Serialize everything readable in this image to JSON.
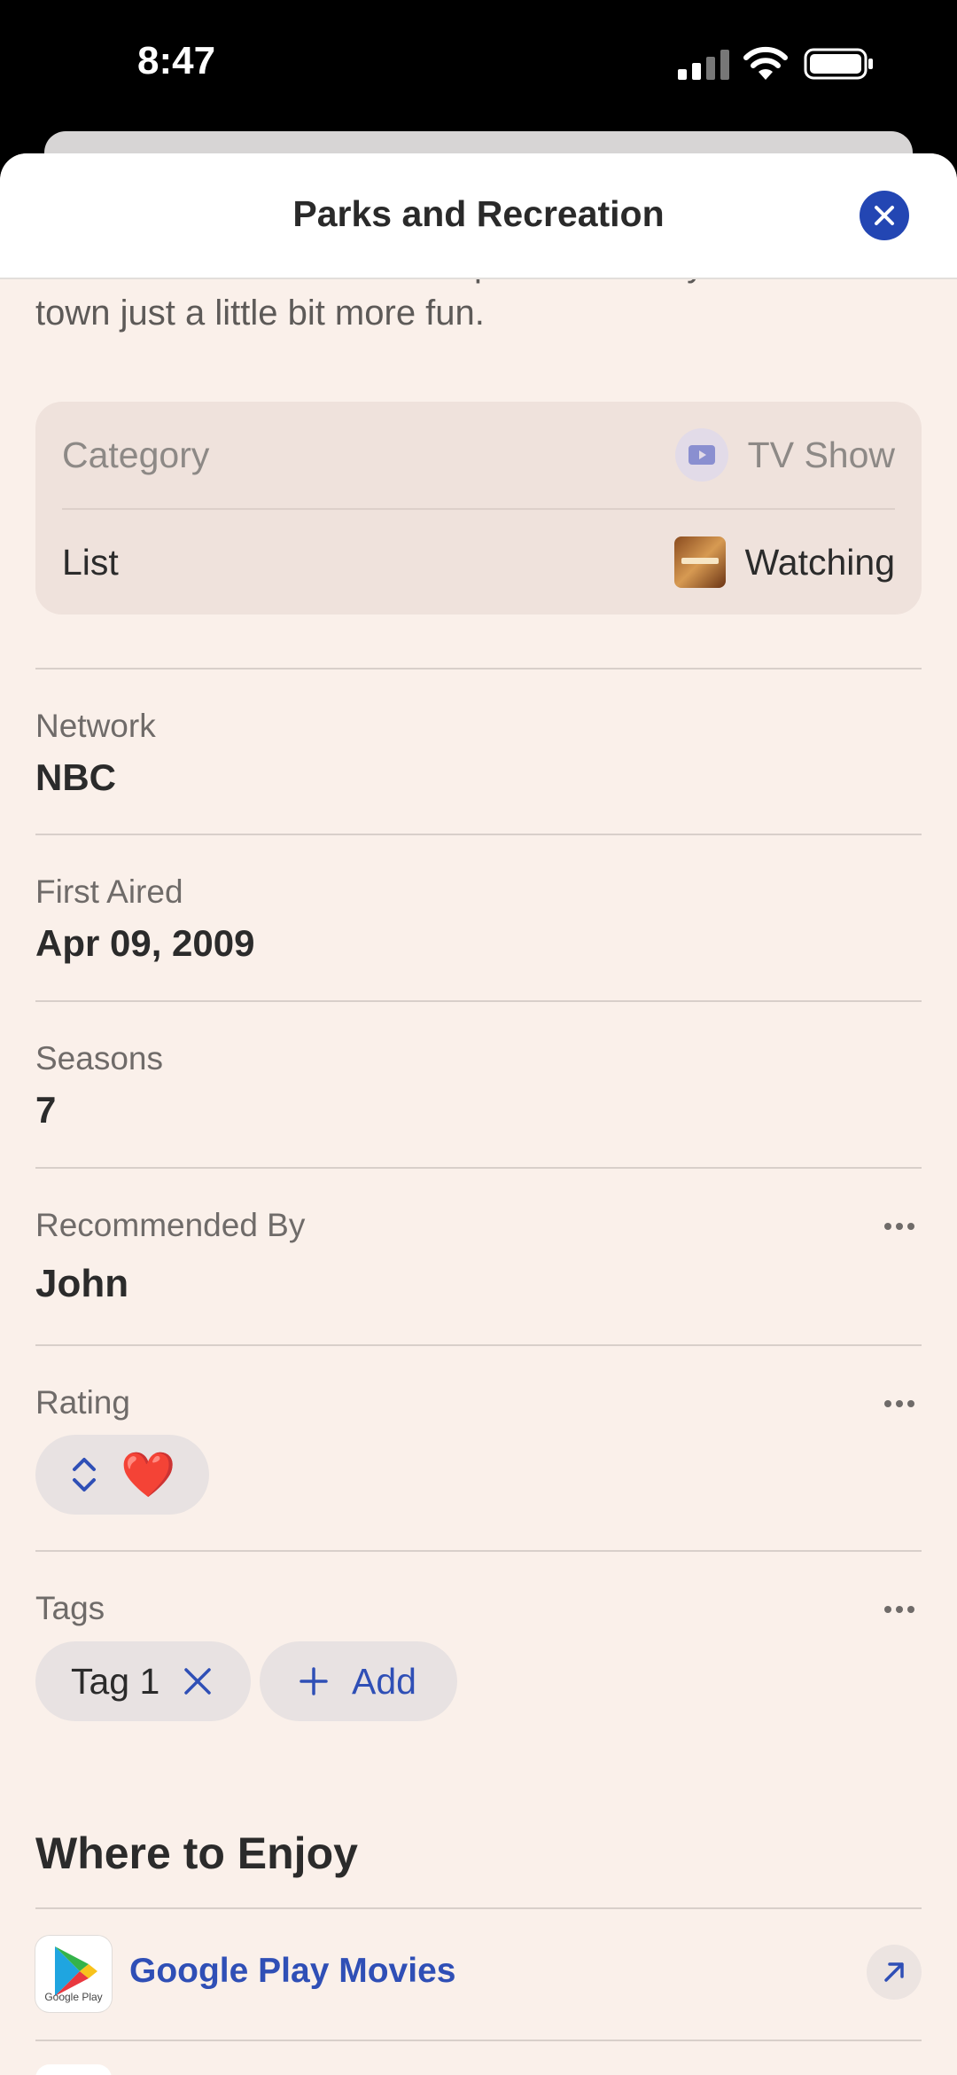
{
  "status_bar": {
    "time": "8:47"
  },
  "sheet": {
    "title": "Parks and Recreation",
    "description": "tireless efforts to make her quintessentially American town just a little bit more fun."
  },
  "category_card": {
    "category_label": "Category",
    "category_value": "TV Show",
    "list_label": "List",
    "list_value": "Watching"
  },
  "fields": {
    "network": {
      "label": "Network",
      "value": "NBC"
    },
    "first_aired": {
      "label": "First Aired",
      "value": "Apr 09, 2009"
    },
    "seasons": {
      "label": "Seasons",
      "value": "7"
    },
    "recommended_by": {
      "label": "Recommended By",
      "value": "John"
    },
    "rating": {
      "label": "Rating",
      "value": "❤️"
    },
    "tags": {
      "label": "Tags",
      "items": [
        "Tag 1"
      ],
      "add_label": "Add"
    }
  },
  "where_to_enjoy": {
    "title": "Where to Enjoy",
    "providers": [
      {
        "name": "Google Play Movies",
        "icon_caption": "Google Play"
      }
    ]
  },
  "colors": {
    "accent": "#2f4fb6",
    "close_button": "#2346b3",
    "background": "#faf0ea"
  }
}
